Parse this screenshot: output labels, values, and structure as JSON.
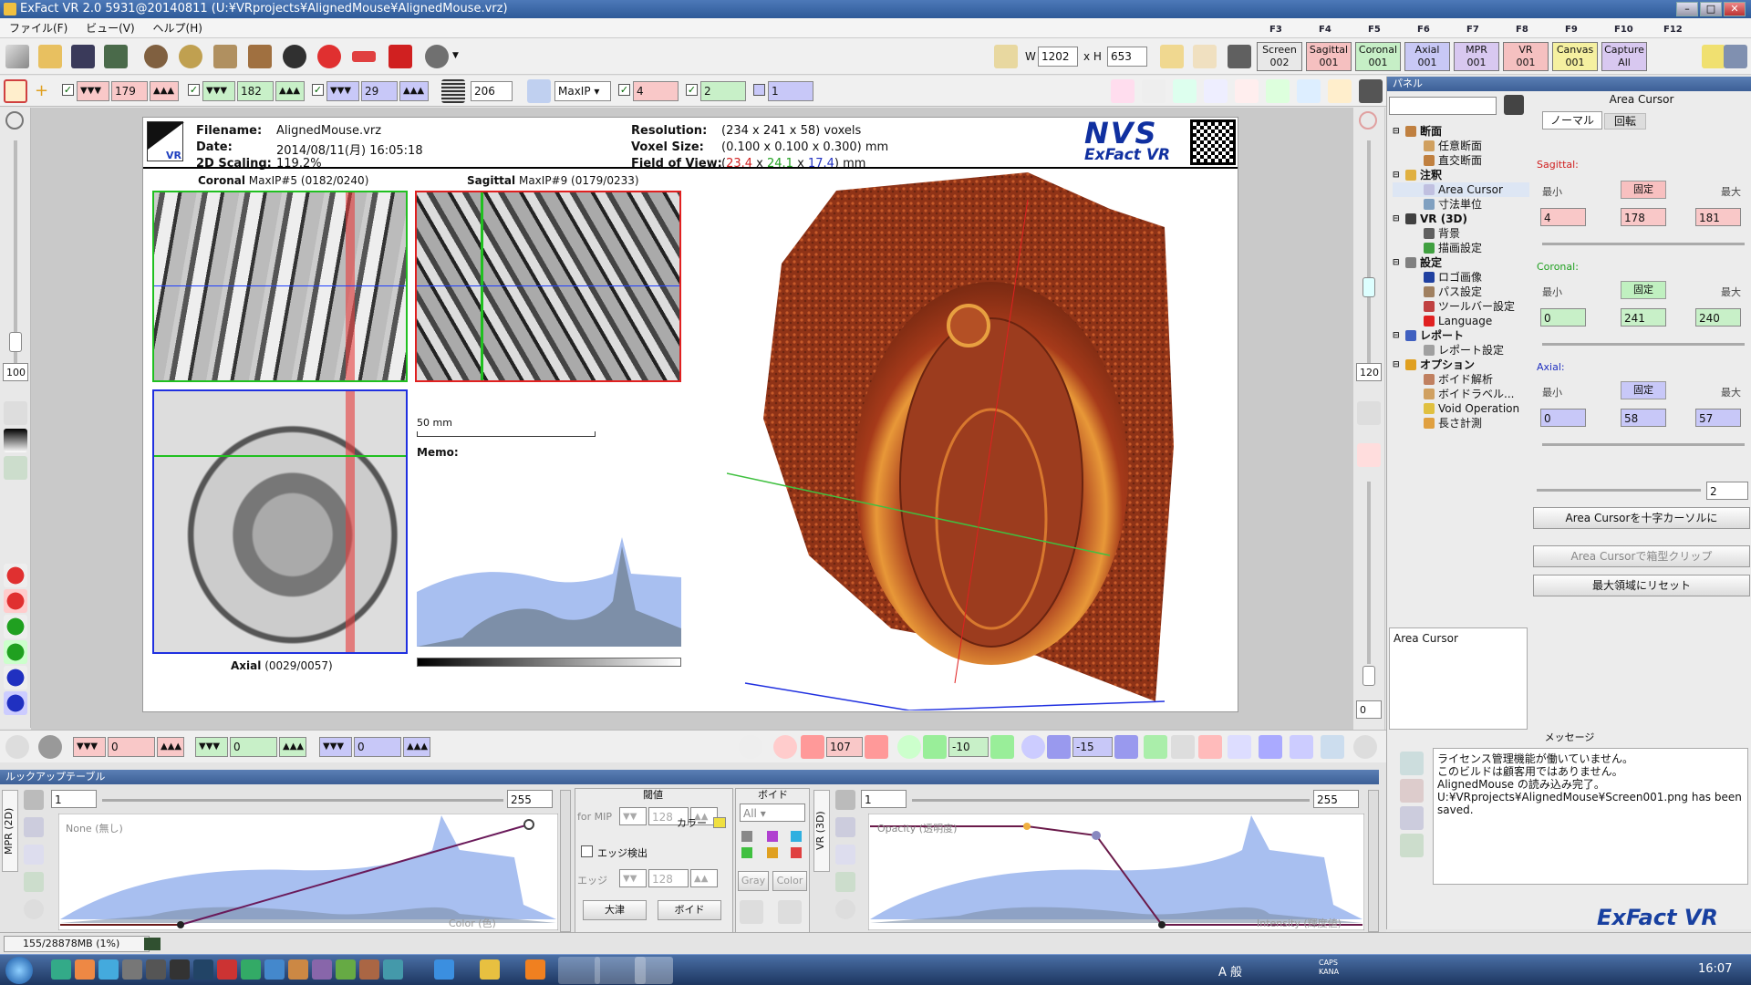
{
  "window": {
    "title": "ExFact VR 2.0 5931@20140811 (U:¥VRprojects¥AlignedMouse¥AlignedMouse.vrz)"
  },
  "menu": [
    "ファイル(F)",
    "ビュー(V)",
    "ヘルプ(H)"
  ],
  "fkeys": [
    "F3",
    "F4",
    "F5",
    "F6",
    "F7",
    "F8",
    "F9",
    "F10",
    "F12"
  ],
  "toolbar": {
    "w_label": "W",
    "w_value": "1202",
    "h_label": "x H",
    "h_value": "653",
    "views": [
      {
        "line1": "Screen",
        "line2": "002",
        "color": "#e8e8e8"
      },
      {
        "line1": "Sagittal",
        "line2": "001",
        "color": "#f5c0c0"
      },
      {
        "line1": "Coronal",
        "line2": "001",
        "color": "#c6efc6"
      },
      {
        "line1": "Axial",
        "line2": "001",
        "color": "#c8c8f5"
      },
      {
        "line1": "MPR",
        "line2": "001",
        "color": "#d8c8f0"
      },
      {
        "line1": "VR",
        "line2": "001",
        "color": "#f5c0c0"
      },
      {
        "line1": "Canvas",
        "line2": "001",
        "color": "#f5f0a0"
      },
      {
        "line1": "Capture",
        "line2": "All",
        "color": "#d8c8f0"
      }
    ],
    "sag_value": "179",
    "cor_value": "182",
    "ax_value": "29",
    "thickness": "206",
    "projection": "MaxIP",
    "mip_value": "4",
    "slab_a": "2",
    "slab_b": "1"
  },
  "info": {
    "filename_label": "Filename:",
    "filename": "AlignedMouse.vrz",
    "date_label": "Date:",
    "date": "2014/08/11(月) 16:05:18",
    "scaling_label": "2D Scaling:",
    "scaling": "119.2%",
    "resolution_label": "Resolution:",
    "resolution": "(234 x 241 x 58) voxels",
    "voxel_label": "Voxel Size:",
    "voxel": "(0.100 x 0.100 x 0.300) mm",
    "fov_label": "Field of View:",
    "fov_open": "(",
    "fov_a": "23.4",
    "fov_x1": " x ",
    "fov_b": "24.1",
    "fov_x2": " x ",
    "fov_c": "17.4",
    "fov_close": ") mm",
    "logo_top": "NVS",
    "logo_bottom": "ExFact VR",
    "vr_badge": "VR"
  },
  "views": {
    "coronal_title": "Coronal",
    "coronal_sub": "MaxIP#5 (0182/0240)",
    "sagittal_title": "Sagittal",
    "sagittal_sub": "MaxIP#9 (0179/0233)",
    "axial_title": "Axial",
    "axial_sub": "(0029/0057)",
    "scalebar": "50 mm",
    "memo": "Memo:"
  },
  "left": {
    "zoom": "100"
  },
  "right_strip": {
    "zoom": "120",
    "bottom": "0"
  },
  "panel": {
    "title": "パネル",
    "cursor_title": "Area Cursor",
    "tree": [
      {
        "label": "断面",
        "level": 0,
        "bold": true,
        "color": "#c08040"
      },
      {
        "label": "任意断面",
        "level": 1,
        "color": "#d0a060"
      },
      {
        "label": "直交断面",
        "level": 1,
        "color": "#c08040"
      },
      {
        "label": "注釈",
        "level": 0,
        "bold": true,
        "color": "#e0b040"
      },
      {
        "label": "Area Cursor",
        "level": 1,
        "color": "#c0c0e0",
        "selected": true
      },
      {
        "label": "寸法単位",
        "level": 1,
        "color": "#80a0c0"
      },
      {
        "label": "VR (3D)",
        "level": 0,
        "bold": true,
        "color": "#404040"
      },
      {
        "label": "背景",
        "level": 1,
        "color": "#606060"
      },
      {
        "label": "描画設定",
        "level": 1,
        "color": "#40a040"
      },
      {
        "label": "設定",
        "level": 0,
        "bold": true,
        "color": "#808080"
      },
      {
        "label": "ロゴ画像",
        "level": 1,
        "color": "#2040a0"
      },
      {
        "label": "パス設定",
        "level": 1,
        "color": "#a08060"
      },
      {
        "label": "ツールバー設定",
        "level": 1,
        "color": "#c04040"
      },
      {
        "label": "Language",
        "level": 1,
        "color": "#e02020"
      },
      {
        "label": "レポート",
        "level": 0,
        "bold": true,
        "color": "#4060c0"
      },
      {
        "label": "レポート設定",
        "level": 1,
        "color": "#a0a0a0"
      },
      {
        "label": "オプション",
        "level": 0,
        "bold": true,
        "color": "#e0a020"
      },
      {
        "label": "ボイド解析",
        "level": 1,
        "color": "#c08060"
      },
      {
        "label": "ボイドラベル...",
        "level": 1,
        "color": "#d0a060"
      },
      {
        "label": "Void Operation",
        "level": 1,
        "color": "#e0c040"
      },
      {
        "label": "長さ計測",
        "level": 1,
        "color": "#e0a040"
      }
    ],
    "desc_title": "Area Cursor",
    "tabs": [
      "ノーマル",
      "回転"
    ],
    "sagittal": {
      "label": "Sagittal:",
      "min_label": "最小",
      "fix": "固定",
      "max_label": "最大",
      "min": "4",
      "mid": "178",
      "max": "181"
    },
    "coronal": {
      "label": "Coronal:",
      "min_label": "最小",
      "fix": "固定",
      "max_label": "最大",
      "min": "0",
      "mid": "241",
      "max": "240"
    },
    "axial": {
      "label": "Axial:",
      "min_label": "最小",
      "fix": "固定",
      "max_label": "最大",
      "min": "0",
      "mid": "58",
      "max": "57"
    },
    "slider_value": "2",
    "btn1": "Area Cursorを十字カーソルに",
    "btn2": "Area Cursorで箱型クリップ",
    "btn3": "最大領域にリセット",
    "message_title": "メッセージ",
    "messages": [
      "ライセンス管理機能が働いていません。",
      "このビルドは顧客用ではありません。",
      "AlignedMouse の読み込み完了。",
      "U:¥VRprojects¥AlignedMouse¥Screen001.png has been saved."
    ],
    "brand": "ExFact VR"
  },
  "bottom": {
    "sag": "0",
    "cor": "0",
    "ax": "0",
    "vr_a": "107",
    "vr_b": "-10",
    "vr_c": "-15"
  },
  "lut": {
    "title": "ルックアップテーブル",
    "mpr_tab": "MPR (2D)",
    "vr_tab": "VR (3D)",
    "mpr_min": "1",
    "mpr_max": "255",
    "mpr_mode": "None (無し)",
    "mpr_axis": "Color (色)",
    "threshold_title": "閾値",
    "for_mip": "for MIP",
    "mip_val": "128",
    "edge_detect": "エッジ検出",
    "edge_label": "エッジ",
    "edge_val": "128",
    "btn_otsu": "大津",
    "btn_void": "ボイド",
    "void_title": "ボイド",
    "void_all": "All",
    "color_label": "カラー",
    "btn_gray": "Gray",
    "btn_color": "Color",
    "vr_min": "1",
    "vr_max": "255",
    "vr_mode": "Opacity (透明度)",
    "vr_axis": "Intensity (輝度値)"
  },
  "status": {
    "memory": "155/28878MB (1%)"
  },
  "taskbar": {
    "tray": "A 般",
    "caps": "CAPS KANA",
    "time": "16:07"
  }
}
